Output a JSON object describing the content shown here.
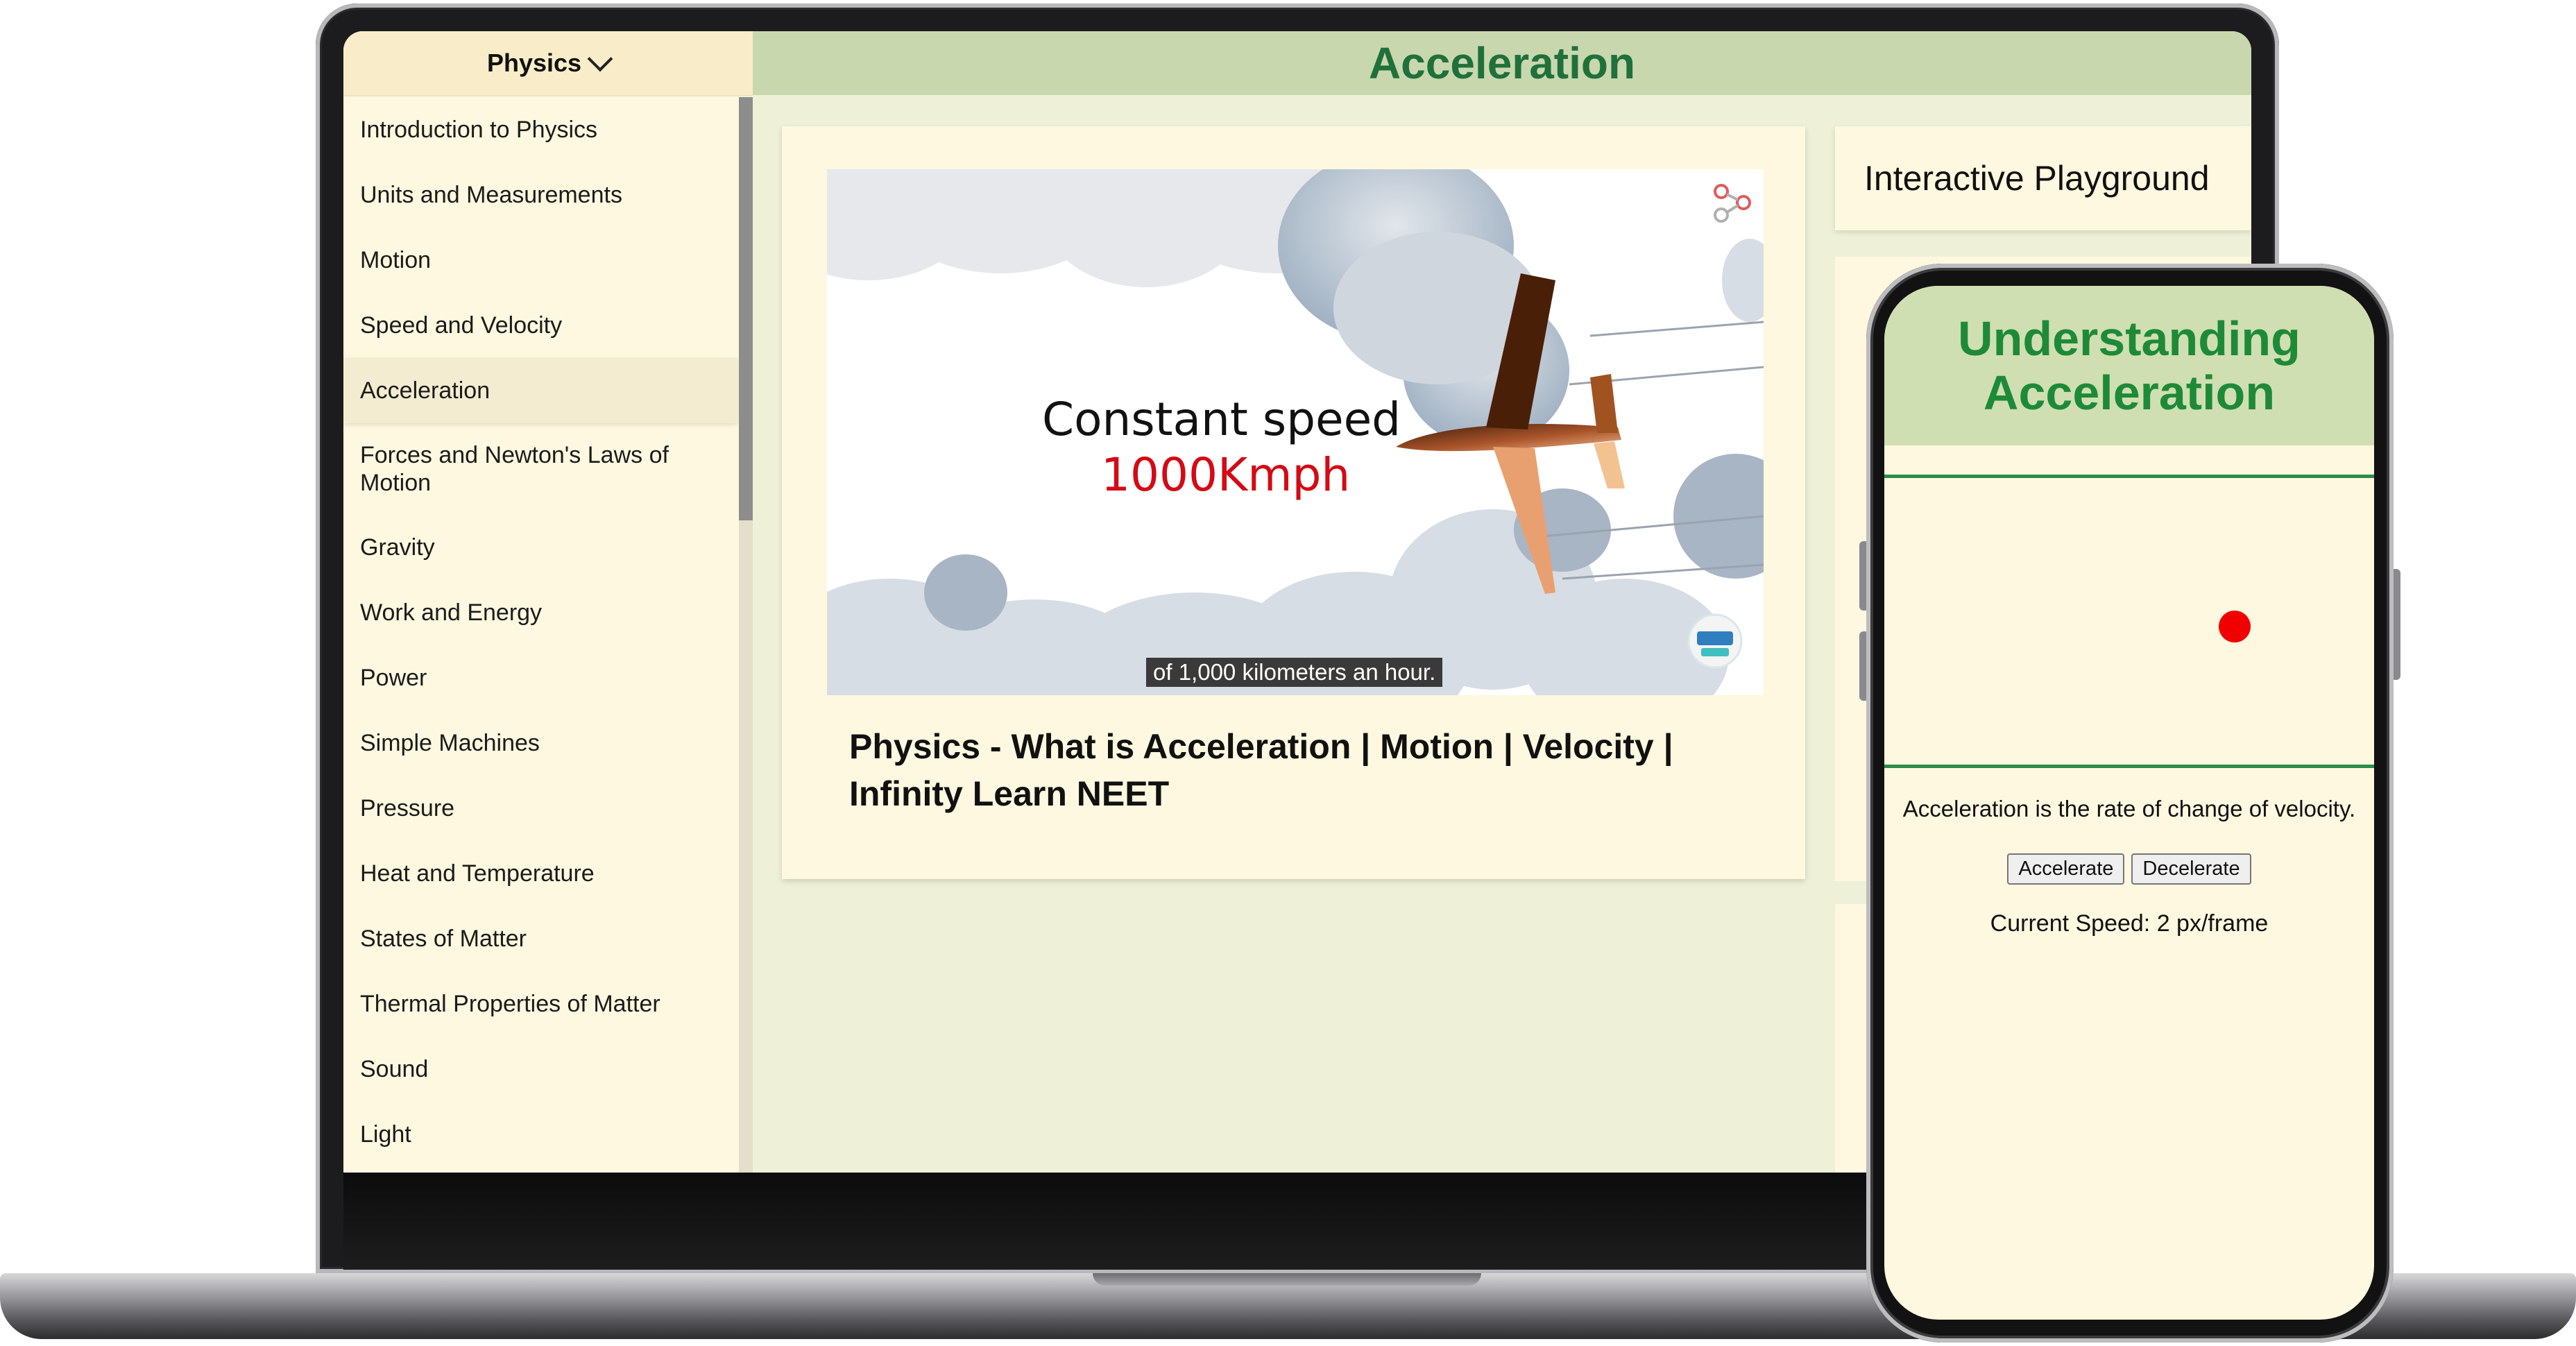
{
  "sidebar": {
    "subject": "Physics",
    "topics": [
      {
        "label": "Introduction to Physics"
      },
      {
        "label": "Units and Measurements"
      },
      {
        "label": "Motion"
      },
      {
        "label": "Speed and Velocity"
      },
      {
        "label": "Acceleration",
        "active": true
      },
      {
        "label": "Forces and Newton's Laws of Motion"
      },
      {
        "label": "Gravity"
      },
      {
        "label": "Work and Energy"
      },
      {
        "label": "Power"
      },
      {
        "label": "Simple Machines"
      },
      {
        "label": "Pressure"
      },
      {
        "label": "Heat and Temperature"
      },
      {
        "label": "States of Matter"
      },
      {
        "label": "Thermal Properties of Matter"
      },
      {
        "label": "Sound"
      },
      {
        "label": "Light"
      }
    ]
  },
  "header": {
    "title": "Acceleration"
  },
  "video": {
    "thumbnail_line1": "Constant speed",
    "thumbnail_line2": "1000Kmph",
    "caption": "of 1,000 kilometers an hour.",
    "title": "Physics - What is Acceleration | Motion | Velocity | Infinity Learn NEET",
    "icons": [
      "share-icon",
      "infinity-learn-logo"
    ]
  },
  "playground": {
    "title": "Interactive Playground"
  },
  "phone": {
    "title": "Understanding Acceleration",
    "description": "Acceleration is the rate of change of velocity.",
    "accelerate_label": "Accelerate",
    "decelerate_label": "Decelerate",
    "speed_text": "Current Speed: 2 px/frame"
  },
  "colors": {
    "header_bg": "#c9d7af",
    "title_green": "#20703a",
    "panel_bg": "#fdf8df",
    "page_bg": "#eef1d8",
    "ball": "#f00000"
  }
}
